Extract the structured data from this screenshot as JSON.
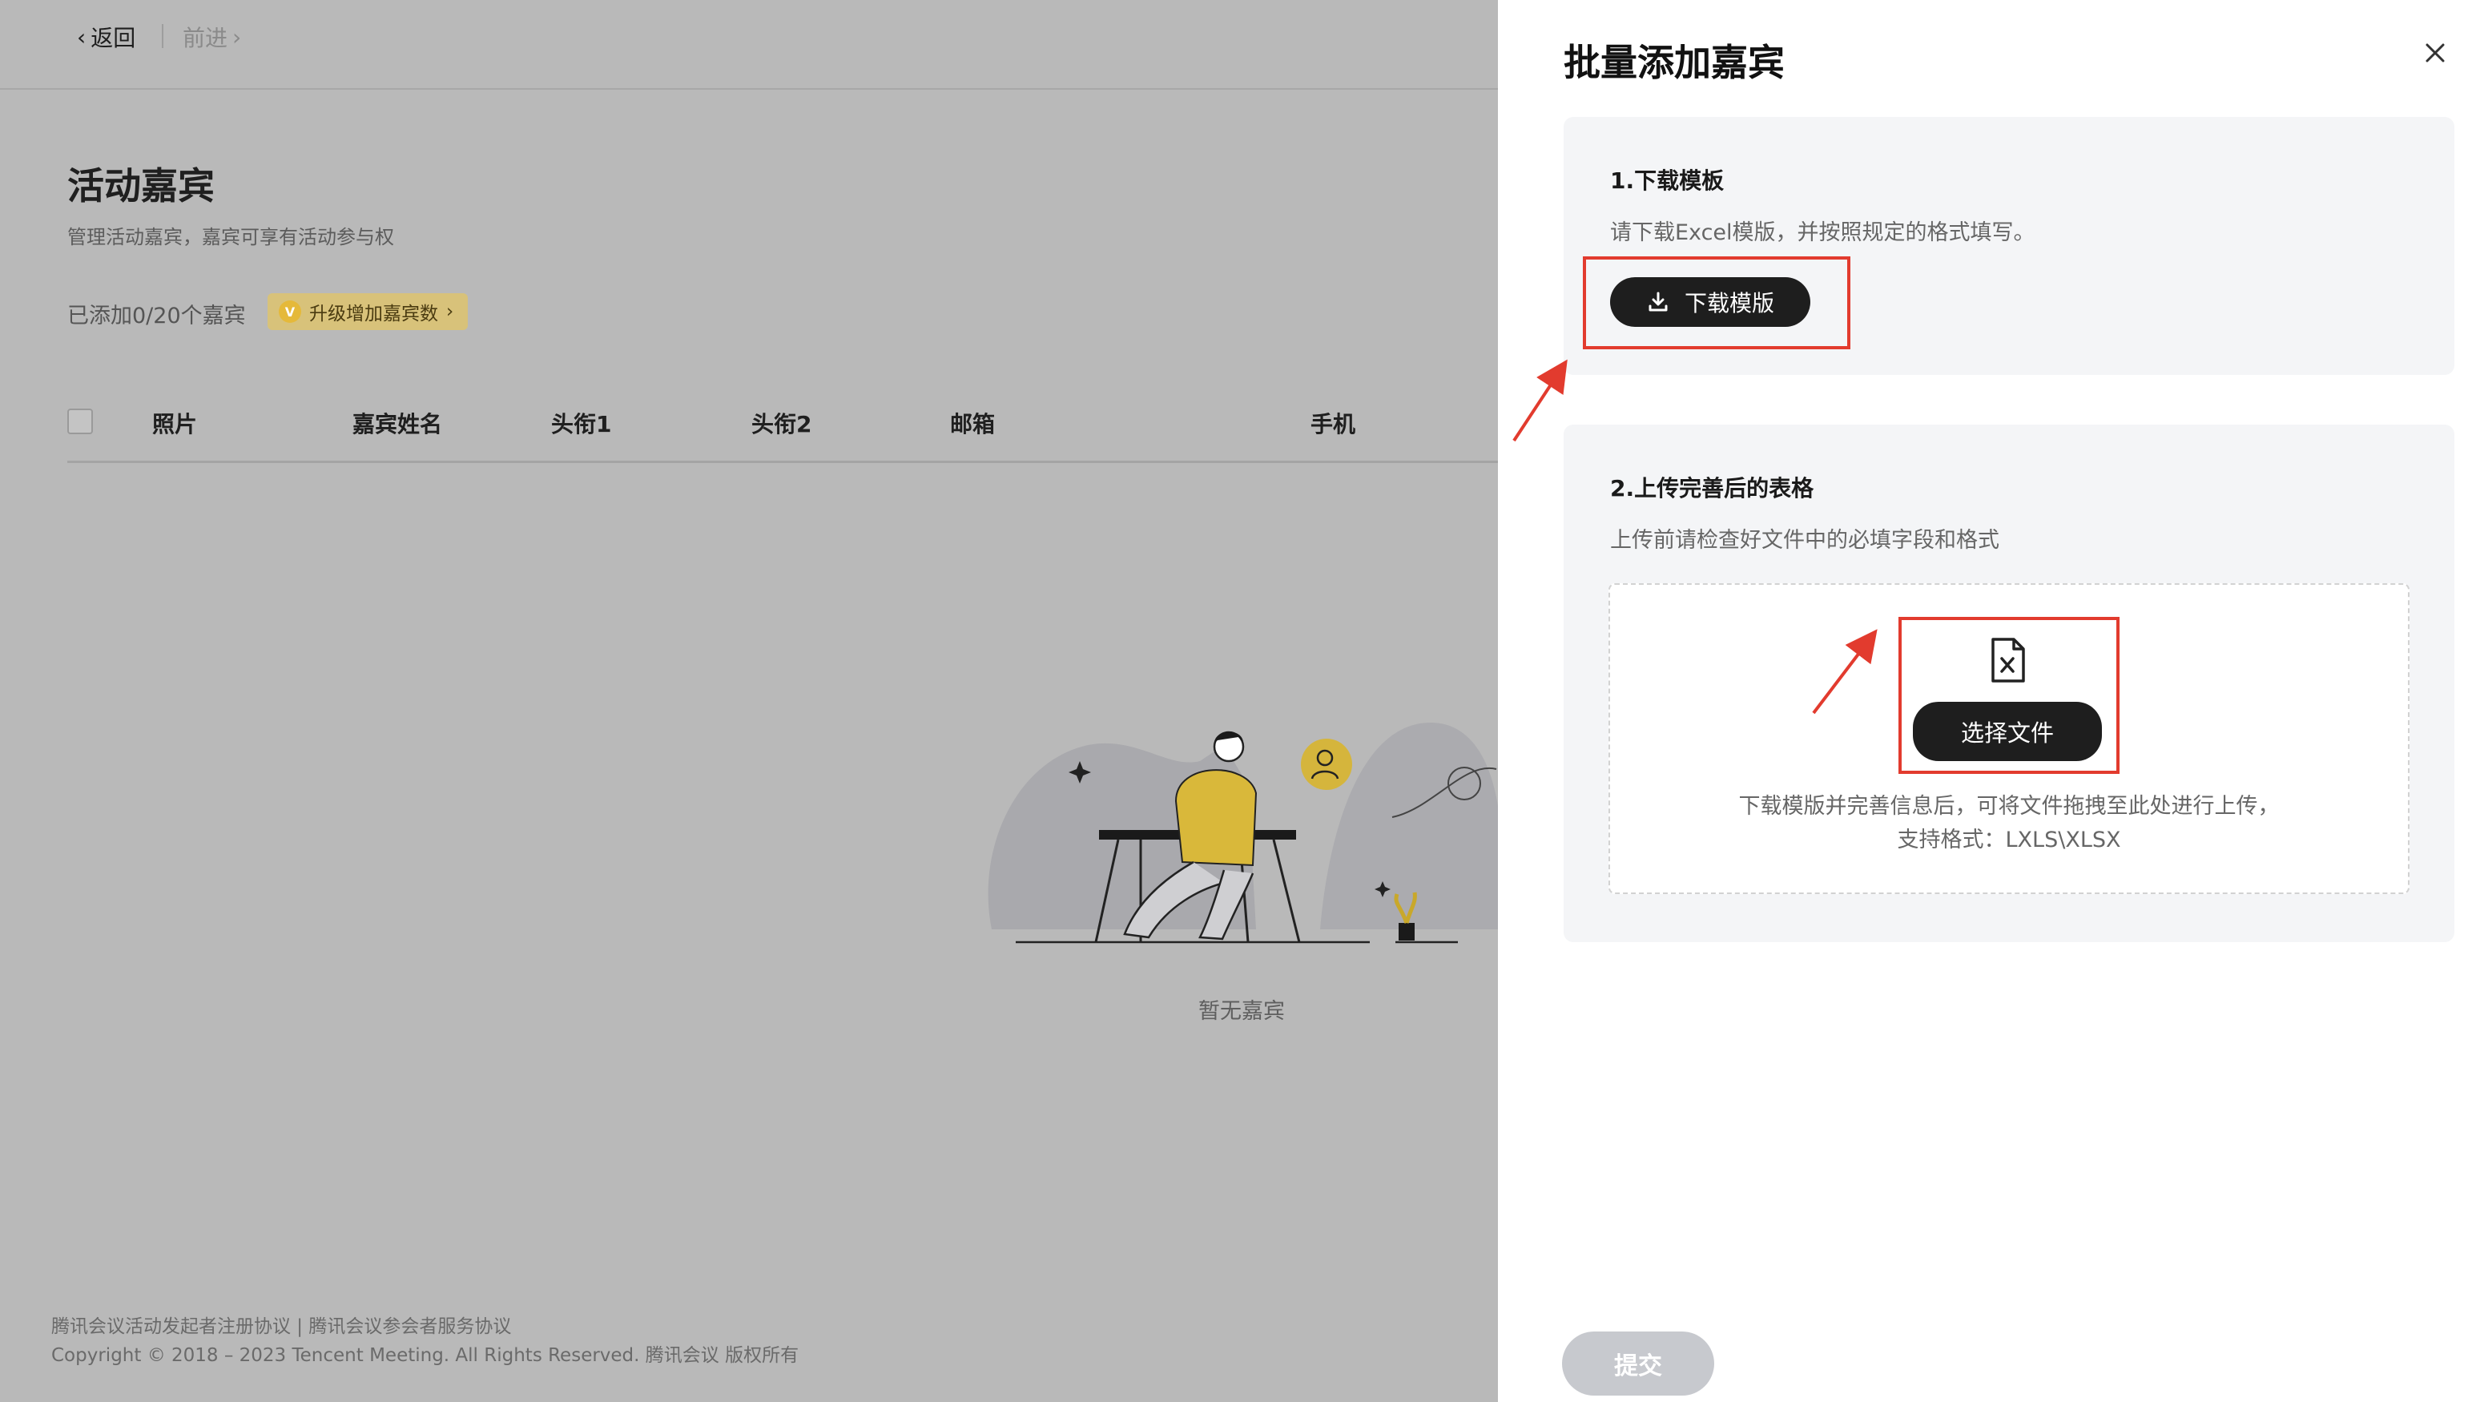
{
  "nav": {
    "back_label": "返回",
    "forward_label": "前进"
  },
  "page": {
    "title": "活动嘉宾",
    "subtitle": "管理活动嘉宾，嘉宾可享有活动参与权",
    "count_text": "已添加0/20个嘉宾",
    "upgrade_label": "升级增加嘉宾数",
    "upgrade_badge_letter": "V"
  },
  "table": {
    "columns": [
      "照片",
      "嘉宾姓名",
      "头衔1",
      "头衔2",
      "邮箱",
      "手机"
    ],
    "empty_text": "暂无嘉宾"
  },
  "footer": {
    "links": "腾讯会议活动发起者注册协议 | 腾讯会议参会者服务协议",
    "copyright": "Copyright © 2018 – 2023 Tencent Meeting. All Rights Reserved. 腾讯会议 版权所有"
  },
  "drawer": {
    "title": "批量添加嘉宾",
    "step1": {
      "title": "1.下载模板",
      "desc": "请下载Excel模版，并按照规定的格式填写。",
      "button_label": "下载模版"
    },
    "step2": {
      "title": "2.上传完善后的表格",
      "desc": "上传前请检查好文件中的必填字段和格式",
      "button_label": "选择文件",
      "hint_line1": "下载模版并完善信息后，可将文件拖拽至此处进行上传，",
      "hint_line2": "支持格式：LXLS\\XLSX"
    },
    "submit_label": "提交"
  },
  "colors": {
    "overlay_bg": "#b9b9b9",
    "accent_dark": "#1e1e1e",
    "highlight_red": "#e23b2e",
    "upgrade_gold": "#d8c27a",
    "submit_disabled": "#c7c9ce"
  },
  "icons": [
    "chevron-left-icon",
    "chevron-right-icon",
    "vip-icon",
    "download-icon",
    "excel-file-icon",
    "close-icon"
  ]
}
